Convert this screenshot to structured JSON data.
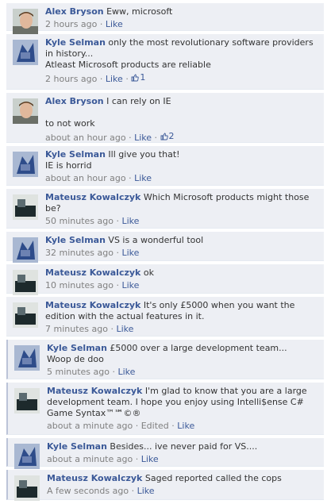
{
  "comments": [
    {
      "author": "Alex Bryson",
      "text": "Eww, microsoft",
      "time": "2 hours ago",
      "like": "Like",
      "avatar": "alex"
    },
    {
      "author": "Kyle Selman",
      "text": "only the most revolutionary software providers in history...\nAtleast Microsoft products are reliable",
      "time": "2 hours ago",
      "like": "Like",
      "likes": "1",
      "avatar": "kyle"
    },
    {
      "author": "Alex Bryson",
      "text": "I can rely on IE\n\nto not work",
      "time": "about an hour ago",
      "like": "Like",
      "likes": "2",
      "avatar": "alex"
    },
    {
      "author": "Kyle Selman",
      "text": "Ill give you that!\nIE is horrid",
      "time": "about an hour ago",
      "like": "Like",
      "avatar": "kyle"
    },
    {
      "author": "Mateusz Kowalczyk",
      "text": "Which Microsoft products might those be?",
      "time": "50 minutes ago",
      "like": "Like",
      "avatar": "mateusz"
    },
    {
      "author": "Kyle Selman",
      "text": "VS is a wonderful tool",
      "time": "32 minutes ago",
      "like": "Like",
      "avatar": "kyle"
    },
    {
      "author": "Mateusz Kowalczyk",
      "text": "ok",
      "time": "10 minutes ago",
      "like": "Like",
      "avatar": "mateusz"
    },
    {
      "author": "Mateusz Kowalczyk",
      "text": "It's only £5000 when you want the edition with the actual features in it.",
      "time": "7 minutes ago",
      "like": "Like",
      "avatar": "mateusz"
    },
    {
      "author": "Kyle Selman",
      "text": "£5000 over a large development team...\nWoop de doo",
      "time": "5 minutes ago",
      "like": "Like",
      "avatar": "kyle"
    },
    {
      "author": "Mateusz Kowalczyk",
      "text": "I'm glad to know that you are a large development team. I hope you enjoy using Intelli$ense C# Game Syntax™℠©®",
      "time": "about a minute ago",
      "edited": "Edited",
      "like": "Like",
      "avatar": "mateusz"
    },
    {
      "author": "Kyle Selman",
      "text": "Besides... ive never paid for VS....",
      "time": "about a minute ago",
      "like": "Like",
      "avatar": "kyle"
    },
    {
      "author": "Mateusz Kowalczyk",
      "text": "Saged reported called the cops",
      "time": "A few seconds ago",
      "like": "Like",
      "avatar": "mateusz"
    }
  ]
}
